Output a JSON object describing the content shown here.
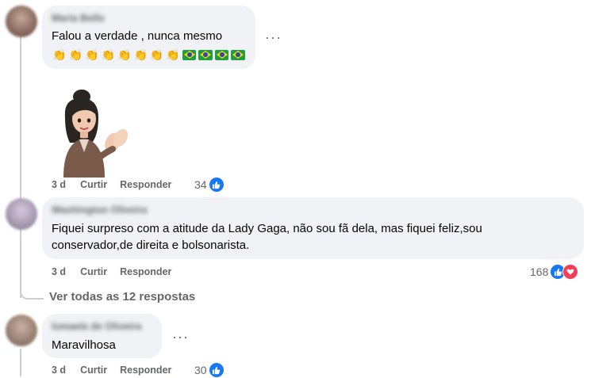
{
  "comments": [
    {
      "author": "Maria Bello",
      "text": "Falou a verdade , nunca mesmo",
      "emojis": {
        "claps": 8,
        "flags": 4
      },
      "more_icon": "ellipsis-icon",
      "time": "3 d",
      "like_label": "Curtir",
      "reply_label": "Responder",
      "reaction_count": "34",
      "reaction_icons": [
        "like-icon"
      ]
    },
    {
      "author": "Washington Oliveira",
      "text_line1": "Fiquei surpreso com a atitude da Lady Gaga, não sou fã dela, mas fiquei feliz,sou",
      "text_line2": "conservador,de direita e bolsonarista.",
      "time": "3 d",
      "like_label": "Curtir",
      "reply_label": "Responder",
      "reaction_count": "168",
      "reaction_icons": [
        "like-icon",
        "love-icon"
      ]
    },
    {
      "author": "Ismaela de Oliveira",
      "text": "Maravilhosa",
      "more_icon": "ellipsis-icon",
      "time": "3 d",
      "like_label": "Curtir",
      "reply_label": "Responder",
      "reaction_count": "30",
      "reaction_icons": [
        "like-icon"
      ]
    }
  ],
  "view_replies": "Ver todas as 12 respostas",
  "colors": {
    "bubble": "#f0f2f5",
    "meta_text": "#65676b",
    "like_blue": "#1877f2",
    "love_red": "#f33e58"
  }
}
